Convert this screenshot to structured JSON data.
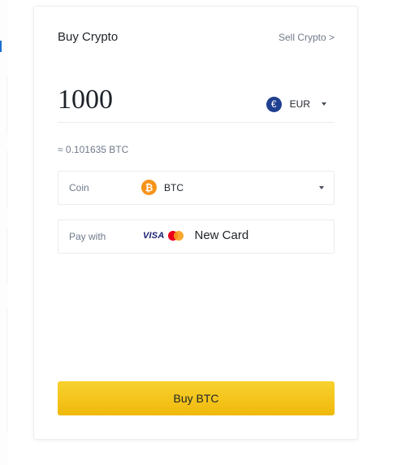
{
  "header": {
    "title": "Buy Crypto",
    "sell_link": "Sell Crypto >"
  },
  "amount": {
    "value": "1000",
    "currency_icon": "euro-icon",
    "currency_symbol": "€",
    "currency": "EUR"
  },
  "conversion": {
    "text": "≈ 0.101635 BTC"
  },
  "coin": {
    "label": "Coin",
    "icon": "bitcoin-icon",
    "icon_glyph": "₿",
    "value": "BTC"
  },
  "payment": {
    "label": "Pay with",
    "visa_text": "VISA",
    "method": "New Card"
  },
  "buy_button": {
    "label": "Buy BTC"
  },
  "colors": {
    "accent": "#f0b90b",
    "euro": "#1f3f8f",
    "bitcoin": "#f7931a",
    "text_primary": "#1e2329",
    "text_secondary": "#707a8a"
  }
}
